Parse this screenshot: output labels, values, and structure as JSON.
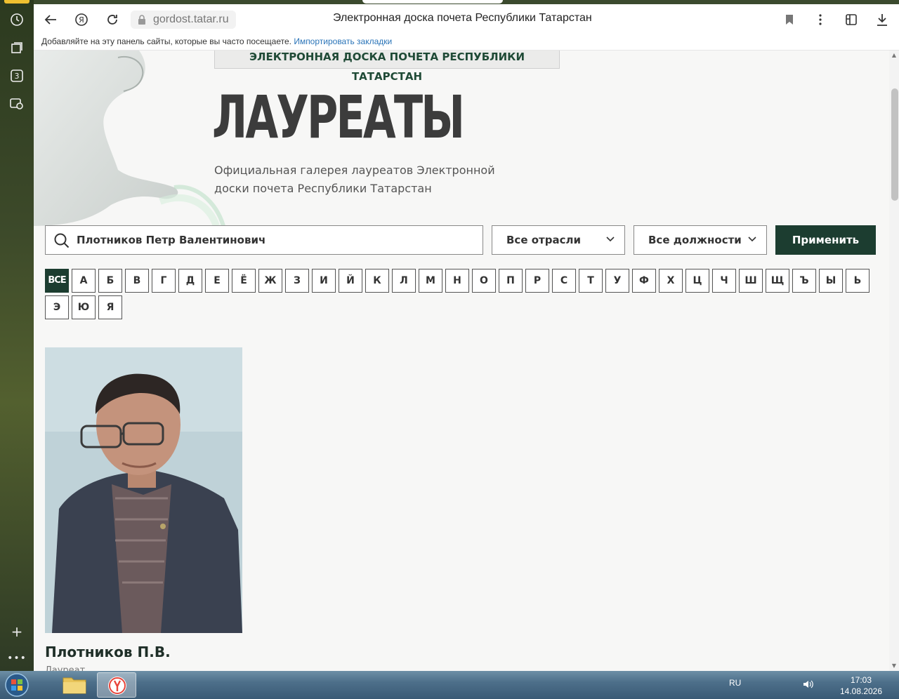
{
  "browser": {
    "url": "gordost.tatar.ru",
    "page_title": "Электронная доска почета Республики Татарстан",
    "bookmarks_bar_text": "Добавляйте на эту панель сайты, которые вы часто посещаете.",
    "bookmarks_bar_link": "Импортировать закладки",
    "sidebar_tab_count": "3"
  },
  "page": {
    "banner": "ЭЛЕКТРОННАЯ ДОСКА ПОЧЕТА РЕСПУБЛИКИ ТАТАРСТАН",
    "title": "ЛАУРЕАТЫ",
    "subtitle_line1": "Официальная галерея лауреатов Электронной",
    "subtitle_line2": "доски почета Республики Татарстан",
    "filters": {
      "search_value": "Плотников Петр Валентинович",
      "industry": "Все отрасли",
      "position": "Все должности",
      "apply": "Применить"
    },
    "letters": [
      "ВСЕ",
      "А",
      "Б",
      "В",
      "Г",
      "Д",
      "Е",
      "Ё",
      "Ж",
      "З",
      "И",
      "Й",
      "К",
      "Л",
      "М",
      "Н",
      "О",
      "П",
      "Р",
      "С",
      "Т",
      "У",
      "Ф",
      "Х",
      "Ц",
      "Ч",
      "Ш",
      "Щ",
      "Ъ",
      "Ы",
      "Ь",
      "Э",
      "Ю",
      "Я"
    ],
    "active_letter": "ВСЕ",
    "result": {
      "name": "Плотников П.В.",
      "role": "Лауреат"
    }
  },
  "taskbar": {
    "language": "RU",
    "time": "17:03",
    "date": "14.08.2026"
  },
  "colors": {
    "primary_green": "#1c3d30",
    "title_gray": "#3c3c3c",
    "link_blue": "#2a74b8"
  }
}
